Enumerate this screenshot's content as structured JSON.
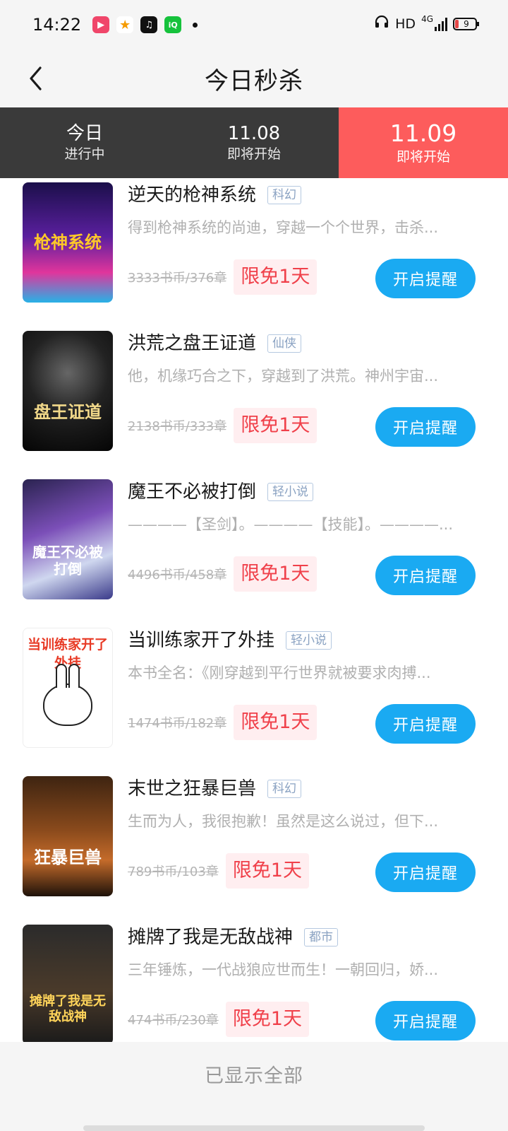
{
  "status_bar": {
    "time": "14:22",
    "network": "HD",
    "network_type": "4G",
    "battery": "9"
  },
  "header": {
    "title": "今日秒杀"
  },
  "tabs": [
    {
      "date": "今日",
      "status": "进行中"
    },
    {
      "date": "11.08",
      "status": "即将开始"
    },
    {
      "date": "11.09",
      "status": "即将开始"
    }
  ],
  "books": [
    {
      "title": "逆天的枪神系统",
      "tag": "科幻",
      "desc": "得到枪神系统的尚迪，穿越一个个世界，击杀...",
      "old_price": "3333书币/376章",
      "free": "限免1天",
      "button": "开启提醒",
      "cover_title": "枪神系统"
    },
    {
      "title": "洪荒之盘王证道",
      "tag": "仙侠",
      "desc": "他，机缘巧合之下，穿越到了洪荒。神州宇宙...",
      "old_price": "2138书币/333章",
      "free": "限免1天",
      "button": "开启提醒",
      "cover_title": "盘王证道"
    },
    {
      "title": "魔王不必被打倒",
      "tag": "轻小说",
      "desc": "————【圣剑】。————【技能】。————...",
      "old_price": "4496书币/458章",
      "free": "限免1天",
      "button": "开启提醒",
      "cover_title": "魔王不必被打倒"
    },
    {
      "title": "当训练家开了外挂",
      "tag": "轻小说",
      "desc": "本书全名：《刚穿越到平行世界就被要求肉搏...",
      "old_price": "1474书币/182章",
      "free": "限免1天",
      "button": "开启提醒",
      "cover_title": "当训练家开了外挂"
    },
    {
      "title": "末世之狂暴巨兽",
      "tag": "科幻",
      "desc": "生而为人，我很抱歉！虽然是这么说过，但下...",
      "old_price": "789书币/103章",
      "free": "限免1天",
      "button": "开启提醒",
      "cover_title": "狂暴巨兽"
    },
    {
      "title": "摊牌了我是无敌战神",
      "tag": "都市",
      "desc": "三年锤炼，一代战狼应世而生！一朝回归，娇...",
      "old_price": "474书币/230章",
      "free": "限免1天",
      "button": "开启提醒",
      "cover_title": "摊牌了我是无敌战神"
    }
  ],
  "footer": {
    "text": "已显示全部"
  }
}
